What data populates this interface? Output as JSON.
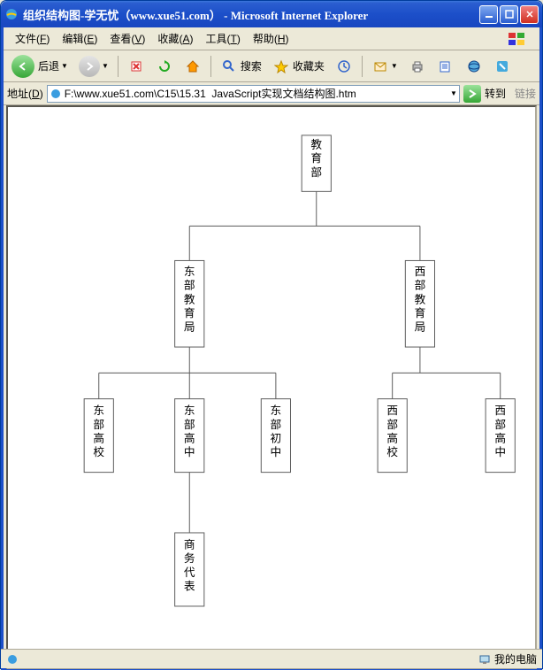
{
  "window": {
    "title": "组织结构图-学无忧（www.xue51.com） - Microsoft Internet Explorer"
  },
  "menu": {
    "file": "文件",
    "file_u": "F",
    "edit": "编辑",
    "edit_u": "E",
    "view": "查看",
    "view_u": "V",
    "fav": "收藏",
    "fav_u": "A",
    "tools": "工具",
    "tools_u": "T",
    "help": "帮助",
    "help_u": "H"
  },
  "toolbar": {
    "back": "后退",
    "search": "搜索",
    "favorites": "收藏夹"
  },
  "address": {
    "label": "地址",
    "label_u": "D",
    "value": "F:\\www.xue51.com\\C15\\15.31  JavaScript实现文档结构图.htm",
    "go": "转到",
    "links": "链接"
  },
  "org": {
    "root": "教育部",
    "l1a": "东部教育局",
    "l1b": "西部教育局",
    "l2a": "东部高校",
    "l2b": "东部高中",
    "l2c": "东部初中",
    "l2d": "西部高校",
    "l2e": "西部高中",
    "l3a": "商务代表"
  },
  "status": {
    "mycomputer": "我的电脑"
  }
}
